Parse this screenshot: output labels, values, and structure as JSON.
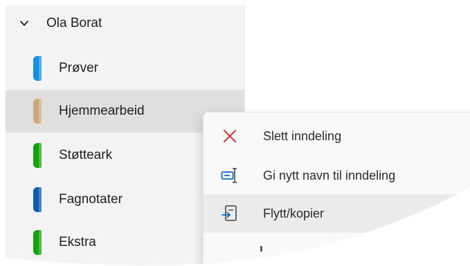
{
  "notebook": {
    "name": "Ola Borat",
    "chevron_icon": "chevron-down-icon"
  },
  "sections": [
    {
      "label": "Prøver",
      "color": "#1490df",
      "selected": false
    },
    {
      "label": "Hjemmearbeid",
      "color": "#c9a77d",
      "selected": true
    },
    {
      "label": "Støtteark",
      "color": "#13a10e",
      "selected": false
    },
    {
      "label": "Fagnotater",
      "color": "#0f5aa8",
      "selected": false
    },
    {
      "label": "Ekstra",
      "color": "#13a10e",
      "selected": false
    }
  ],
  "context_menu": {
    "items": [
      {
        "label": "Slett inndeling",
        "icon": "delete-x-icon",
        "hover": false
      },
      {
        "label": "Gi nytt navn til inndeling",
        "icon": "rename-icon",
        "hover": false
      },
      {
        "label": "Flytt/kopier",
        "icon": "move-copy-icon",
        "hover": true
      }
    ]
  },
  "colors": {
    "nav_background": "#f3f3f3",
    "selected_background": "#e1dfdd",
    "menu_background": "#f9f9f9",
    "menu_hover": "#ebebeb",
    "delete_icon": "#d13438",
    "accent_icon": "#0f6cbd"
  }
}
